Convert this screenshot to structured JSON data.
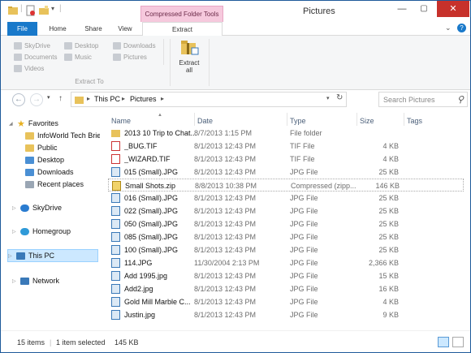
{
  "window": {
    "title": "Pictures",
    "context_tab": "Compressed Folder Tools",
    "help": "?"
  },
  "tabs": [
    "File",
    "Home",
    "Share",
    "View",
    "Extract"
  ],
  "ribbon": {
    "destinations": [
      "SkyDrive",
      "Documents",
      "Videos",
      "Desktop",
      "Music",
      "Downloads",
      "Pictures"
    ],
    "group_label": "Extract To",
    "extract_all": [
      "Extract",
      "all"
    ]
  },
  "address": {
    "segments": [
      "This PC",
      "Pictures"
    ],
    "search_placeholder": "Search Pictures"
  },
  "nav_pane": {
    "favorites": "Favorites",
    "favorite_items": [
      "InfoWorld Tech Brie",
      "Public",
      "Desktop",
      "Downloads",
      "Recent places"
    ],
    "skydrive": "SkyDrive",
    "homegroup": "Homegroup",
    "this_pc": "This PC",
    "network": "Network"
  },
  "columns": {
    "name": "Name",
    "date": "Date",
    "type": "Type",
    "size": "Size",
    "tags": "Tags"
  },
  "files": [
    {
      "name": "2013 10 Trip to Chat...",
      "date": "8/7/2013 1:15 PM",
      "type": "File folder",
      "size": "",
      "icon": "folder"
    },
    {
      "name": "_BUG.TIF",
      "date": "8/1/2013 12:43 PM",
      "type": "TIF File",
      "size": "4 KB",
      "icon": "tif"
    },
    {
      "name": "_WIZARD.TIF",
      "date": "8/1/2013 12:43 PM",
      "type": "TIF File",
      "size": "4 KB",
      "icon": "tif"
    },
    {
      "name": "015 (Small).JPG",
      "date": "8/1/2013 12:43 PM",
      "type": "JPG File",
      "size": "25 KB",
      "icon": "jpg"
    },
    {
      "name": "Small Shots.zip",
      "date": "8/8/2013 10:38 PM",
      "type": "Compressed (zipp...",
      "size": "146 KB",
      "icon": "zip"
    },
    {
      "name": "016 (Small).JPG",
      "date": "8/1/2013 12:43 PM",
      "type": "JPG File",
      "size": "25 KB",
      "icon": "jpg"
    },
    {
      "name": "022 (Small).JPG",
      "date": "8/1/2013 12:43 PM",
      "type": "JPG File",
      "size": "25 KB",
      "icon": "jpg"
    },
    {
      "name": "050 (Small).JPG",
      "date": "8/1/2013 12:43 PM",
      "type": "JPG File",
      "size": "25 KB",
      "icon": "jpg"
    },
    {
      "name": "085 (Small).JPG",
      "date": "8/1/2013 12:43 PM",
      "type": "JPG File",
      "size": "25 KB",
      "icon": "jpg"
    },
    {
      "name": "100 (Small).JPG",
      "date": "8/1/2013 12:43 PM",
      "type": "JPG File",
      "size": "25 KB",
      "icon": "jpg"
    },
    {
      "name": "114.JPG",
      "date": "11/30/2004 2:13 PM",
      "type": "JPG File",
      "size": "2,366 KB",
      "icon": "jpg"
    },
    {
      "name": "Add 1995.jpg",
      "date": "8/1/2013 12:43 PM",
      "type": "JPG File",
      "size": "15 KB",
      "icon": "jpg"
    },
    {
      "name": "Add2.jpg",
      "date": "8/1/2013 12:43 PM",
      "type": "JPG File",
      "size": "16 KB",
      "icon": "jpg"
    },
    {
      "name": "Gold Mill Marble C...",
      "date": "8/1/2013 12:43 PM",
      "type": "JPG File",
      "size": "4 KB",
      "icon": "jpg"
    },
    {
      "name": "Justin.jpg",
      "date": "8/1/2013 12:43 PM",
      "type": "JPG File",
      "size": "9 KB",
      "icon": "jpg"
    }
  ],
  "status": {
    "count": "15 items",
    "selection": "1 item selected",
    "size": "145 KB"
  }
}
